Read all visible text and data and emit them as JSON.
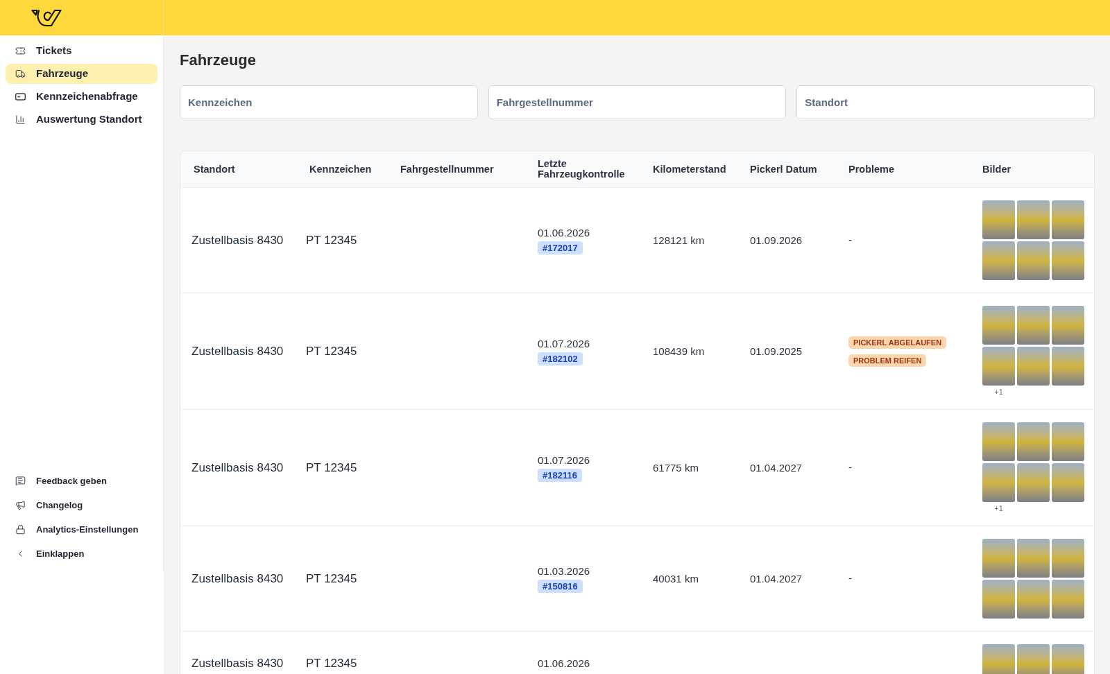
{
  "sidebar": {
    "items": [
      {
        "label": "Tickets",
        "selected": false
      },
      {
        "label": "Fahrzeuge",
        "selected": true
      },
      {
        "label": "Kennzeichenabfrage",
        "selected": false
      },
      {
        "label": "Auswertung Standort",
        "selected": false
      }
    ],
    "footer_items": [
      {
        "label": "Feedback geben"
      },
      {
        "label": "Changelog"
      },
      {
        "label": "Analytics-Einstellungen"
      },
      {
        "label": "Einklappen"
      }
    ]
  },
  "page": {
    "title": "Fahrzeuge"
  },
  "filters": [
    {
      "placeholder": "Kennzeichen"
    },
    {
      "placeholder": "Fahrgestellnummer"
    },
    {
      "placeholder": "Standort"
    }
  ],
  "table": {
    "columns": [
      "Standort",
      "Kennzeichen",
      "Fahrgestellnummer",
      "Letzte Fahrzeugkontrolle",
      "Kilometerstand",
      "Pickerl Datum",
      "Probleme",
      "Bilder"
    ],
    "rows": [
      {
        "standort": "Zustellbasis 8430",
        "kennzeichen": "PT 12345",
        "letzte_kontrolle": "01.06.2026",
        "ticket": "#172017",
        "kilometerstand": "128121 km",
        "pickerl_datum": "01.09.2026",
        "probleme": [
          {
            "kind": "dash",
            "label": "-"
          }
        ],
        "bilder": [
          {
            "kind": "photo"
          },
          {
            "kind": "photo"
          },
          {
            "kind": "photo"
          },
          {
            "kind": "photo"
          },
          {
            "kind": "photo"
          },
          {
            "kind": "photo"
          }
        ]
      },
      {
        "standort": "Zustellbasis 8430",
        "kennzeichen": "PT 12345",
        "letzte_kontrolle": "01.07.2026",
        "ticket": "#182102",
        "kilometerstand": "108439 km",
        "pickerl_datum": "01.09.2025",
        "probleme": [
          {
            "kind": "badge",
            "label": "PICKERL ABGELAUFEN"
          },
          {
            "kind": "badge",
            "label": "PROBLEM REIFEN"
          }
        ],
        "bilder": [
          {
            "kind": "photo"
          },
          {
            "kind": "photo"
          },
          {
            "kind": "photo"
          },
          {
            "kind": "photo"
          },
          {
            "kind": "photo"
          },
          {
            "kind": "photo"
          }
        ],
        "bilder_mehr": "+1"
      },
      {
        "standort": "Zustellbasis 8430",
        "kennzeichen": "PT 12345",
        "letzte_kontrolle": "01.07.2026",
        "ticket": "#182116",
        "kilometerstand": "61775 km",
        "pickerl_datum": "01.04.2027",
        "probleme": [
          {
            "kind": "dash",
            "label": "-"
          }
        ],
        "bilder": [
          {
            "kind": "photo"
          },
          {
            "kind": "photo"
          },
          {
            "kind": "photo"
          },
          {
            "kind": "photo"
          },
          {
            "kind": "photo"
          },
          {
            "kind": "photo"
          }
        ],
        "bilder_mehr": "+1"
      },
      {
        "standort": "Zustellbasis 8430",
        "kennzeichen": "PT 12345",
        "letzte_kontrolle": "01.03.2026",
        "ticket": "#150816",
        "kilometerstand": "40031 km",
        "pickerl_datum": "01.04.2027",
        "probleme": [
          {
            "kind": "dash",
            "label": "-"
          }
        ],
        "bilder": [
          {
            "kind": "photo"
          },
          {
            "kind": "photo"
          },
          {
            "kind": "photo"
          },
          {
            "kind": "photo"
          },
          {
            "kind": "photo"
          },
          {
            "kind": "photo"
          }
        ]
      },
      {
        "standort": "Zustellbasis 8430",
        "kennzeichen": "PT 12345",
        "letzte_kontrolle": "01.06.2026",
        "bilder": [
          {
            "kind": "photo"
          },
          {
            "kind": "photo"
          },
          {
            "kind": "photo"
          }
        ]
      }
    ]
  }
}
